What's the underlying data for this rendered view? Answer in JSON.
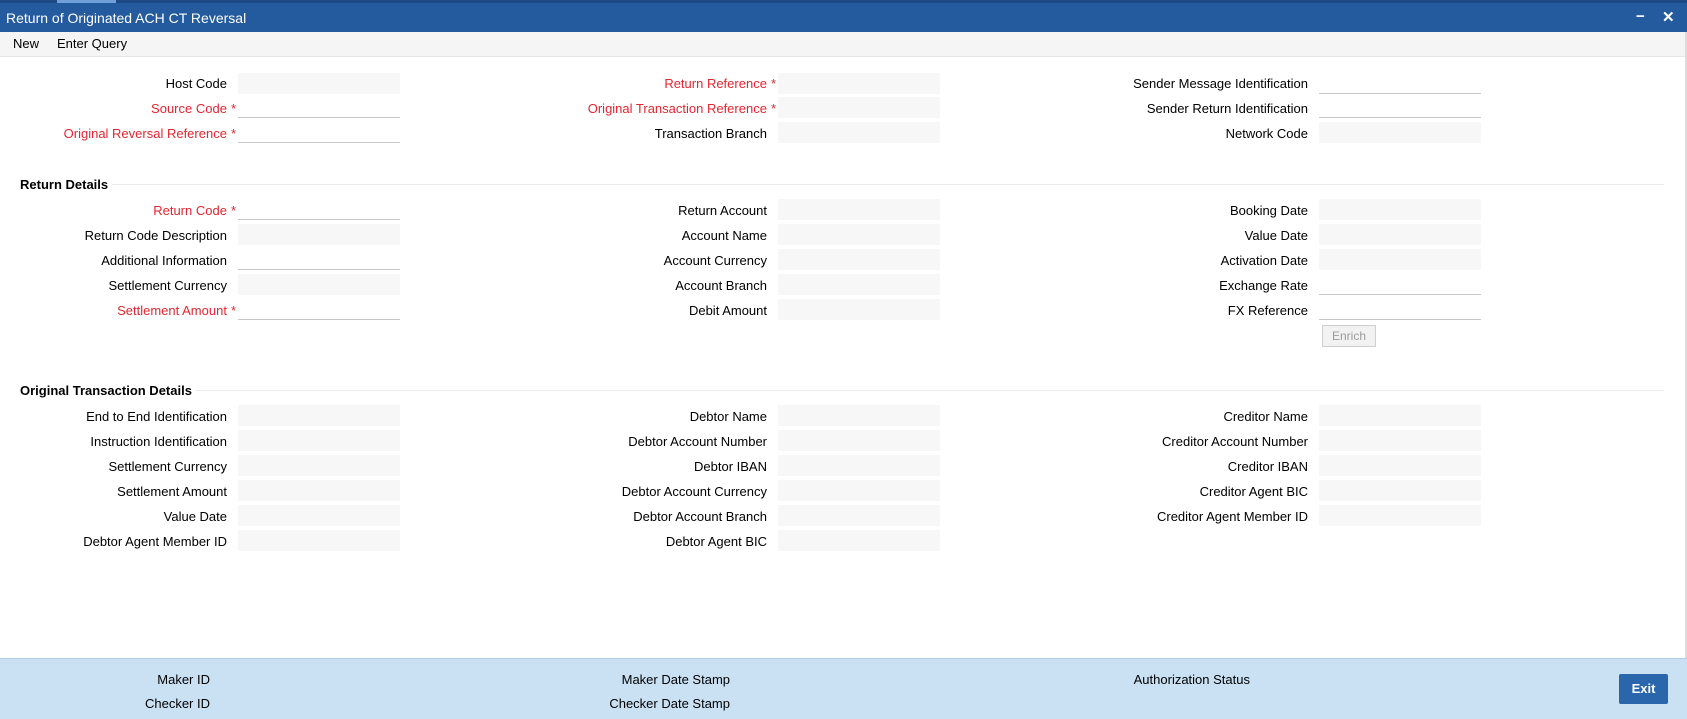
{
  "window": {
    "title": "Return of Originated ACH CT Reversal",
    "minimize_glyph": "−",
    "close_glyph": "✕"
  },
  "menu": {
    "new": "New",
    "enter_query": "Enter Query"
  },
  "header_fields": {
    "host_code": "Host Code",
    "source_code": "Source Code",
    "original_reversal_reference": "Original Reversal Reference",
    "return_reference": "Return Reference",
    "original_transaction_reference": "Original Transaction Reference",
    "transaction_branch": "Transaction Branch",
    "sender_message_identification": "Sender Message Identification",
    "sender_return_identification": "Sender Return Identification",
    "network_code": "Network Code",
    "required_mark": "*"
  },
  "return_details": {
    "title": "Return Details",
    "return_code": "Return Code",
    "return_code_description": "Return Code Description",
    "additional_information": "Additional Information",
    "settlement_currency": "Settlement Currency",
    "settlement_amount": "Settlement Amount",
    "return_account": "Return Account",
    "account_name": "Account Name",
    "account_currency": "Account Currency",
    "account_branch": "Account Branch",
    "debit_amount": "Debit Amount",
    "booking_date": "Booking Date",
    "value_date": "Value Date",
    "activation_date": "Activation Date",
    "exchange_rate": "Exchange Rate",
    "fx_reference": "FX Reference",
    "enrich_button": "Enrich"
  },
  "original_transaction_details": {
    "title": "Original Transaction Details",
    "end_to_end_identification": "End to End Identification",
    "instruction_identification": "Instruction Identification",
    "settlement_currency": "Settlement Currency",
    "settlement_amount": "Settlement Amount",
    "value_date": "Value Date",
    "debtor_agent_member_id": "Debtor Agent Member ID",
    "debtor_name": "Debtor Name",
    "debtor_account_number": "Debtor Account Number",
    "debtor_iban": "Debtor IBAN",
    "debtor_account_currency": "Debtor Account Currency",
    "debtor_account_branch": "Debtor Account Branch",
    "debtor_agent_bic": "Debtor Agent BIC",
    "creditor_name": "Creditor Name",
    "creditor_account_number": "Creditor Account Number",
    "creditor_iban": "Creditor IBAN",
    "creditor_agent_bic": "Creditor Agent BIC",
    "creditor_agent_member_id": "Creditor Agent Member ID"
  },
  "footer": {
    "maker_id": "Maker ID",
    "checker_id": "Checker ID",
    "maker_date_stamp": "Maker Date Stamp",
    "checker_date_stamp": "Checker Date Stamp",
    "authorization_status": "Authorization Status",
    "exit_button": "Exit"
  }
}
